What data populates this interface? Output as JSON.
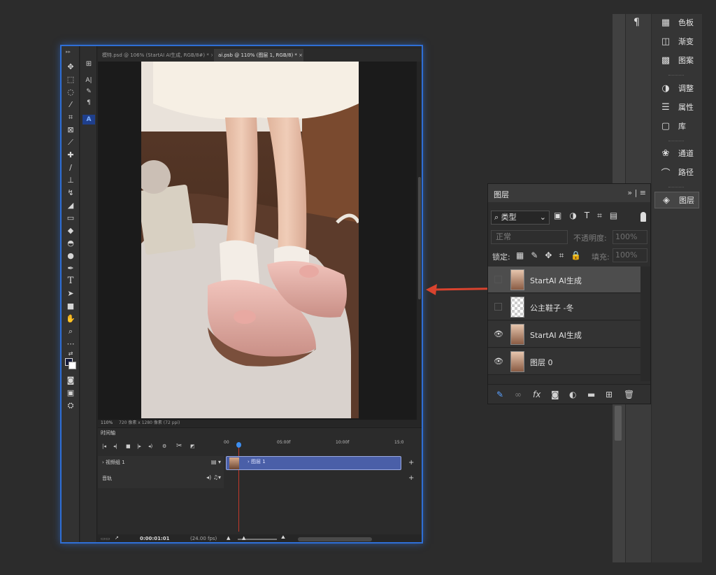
{
  "doc_tabs": [
    {
      "label": "模特.psd @ 106% (StartAI AI生成, RGB/8#) *",
      "active": false
    },
    {
      "label": "ai.psb @ 110% (图层 1, RGB/8) *",
      "active": true
    }
  ],
  "status": {
    "zoom": "110%",
    "size_info": "720 像素 x 1280 像素 (72 ppi)"
  },
  "timeline": {
    "title": "时间轴",
    "ruler": [
      "00",
      "05:00f",
      "10:00f",
      "15:0"
    ],
    "video_group": "视频组 1",
    "audio": "音轨",
    "clip_label": "图层 1",
    "timecode": "0:00:01:01",
    "fps": "(24.00 fps)"
  },
  "panel_dock": {
    "items": [
      {
        "label": "色板",
        "icon": "swatches-icon"
      },
      {
        "label": "渐变",
        "icon": "gradient-icon"
      },
      {
        "label": "图案",
        "icon": "pattern-icon"
      },
      {
        "label": "调整",
        "icon": "adjustments-icon"
      },
      {
        "label": "属性",
        "icon": "properties-icon"
      },
      {
        "label": "库",
        "icon": "libraries-icon"
      },
      {
        "label": "通道",
        "icon": "channels-icon"
      },
      {
        "label": "路径",
        "icon": "paths-icon"
      },
      {
        "label": "图层",
        "icon": "layers-icon"
      }
    ]
  },
  "layers_panel": {
    "title": "图层",
    "filter_label": "类型",
    "blend_mode": "正常",
    "opacity_label": "不透明度:",
    "opacity_value": "100%",
    "lock_label": "锁定:",
    "fill_label": "填充:",
    "fill_value": "100%",
    "layers": [
      {
        "name": "StartAI AI生成",
        "visible": false,
        "selected": true,
        "thumb": "photo"
      },
      {
        "name": "公主鞋子 -冬",
        "visible": false,
        "selected": false,
        "thumb": "transparent"
      },
      {
        "name": "StartAI AI生成",
        "visible": true,
        "selected": false,
        "thumb": "photo"
      },
      {
        "name": "图层 0",
        "visible": true,
        "selected": false,
        "thumb": "photo"
      }
    ]
  },
  "midstrip_icons": [
    "history-icon",
    "character-icon",
    "brush-settings-icon",
    "paragraph-icon",
    "startai-icon"
  ],
  "colors": {
    "accent": "#2f6fd6",
    "arrow": "#d9432e",
    "clip": "#4a5fa8"
  }
}
